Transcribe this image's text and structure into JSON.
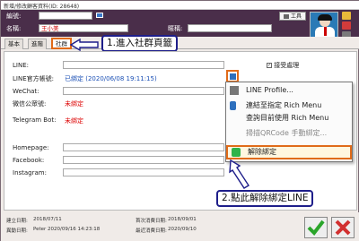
{
  "window": {
    "title": "新增/修改顧客資料(ID: 28648)"
  },
  "header": {
    "code_label": "編號:",
    "name_label": "名稱:",
    "name_value": "王小美",
    "contact_label": "暱稱:",
    "tool_button": "工具"
  },
  "tabs": [
    {
      "label": "基本"
    },
    {
      "label": "進階"
    },
    {
      "label": "社群"
    }
  ],
  "callouts": {
    "step1": "1.進入社群頁籤",
    "step2": "2.點此解除綁定LINE"
  },
  "form": {
    "line_label": "LINE:",
    "line_official_label": "LINE官方帳號:",
    "line_official_status": "已綁定 (2020/06/08 19:11:15)",
    "wechat_label": "WeChat:",
    "wechat_public_label": "微信公眾號:",
    "wechat_public_status": "未綁定",
    "telegram_label": "Telegram Bot:",
    "telegram_status": "未綁定",
    "homepage_label": "Homepage:",
    "facebook_label": "Facebook:",
    "instagram_label": "Instagram:",
    "receive_checkbox_label": "接受處理"
  },
  "context_menu": {
    "items": [
      {
        "label": "LINE Profile...",
        "disabled": false
      },
      {
        "label": "連結至指定 Rich Menu",
        "disabled": false
      },
      {
        "label": "查詢目前使用 Rich Menu",
        "disabled": false
      },
      {
        "label": "掃描QRCode 手動綁定...",
        "disabled": true
      },
      {
        "label": "解除綁定",
        "disabled": false
      }
    ]
  },
  "footer": {
    "created_label": "建立日期:",
    "created_value": "2018/07/11",
    "modified_label": "異動日期:",
    "modified_value": "Peter 2020/09/16 14:23:18",
    "first_purchase_label": "首次消費日期:",
    "first_purchase_value": "2018/09/01",
    "last_purchase_label": "最近消費日期:",
    "last_purchase_value": "2020/09/10"
  },
  "colors": {
    "header_bg": "#4a2e4a",
    "callout_border": "#1e1e8a",
    "highlight": "#e06b1a",
    "bound_blue": "#1a4fb5",
    "unbound_red": "#d00000"
  }
}
